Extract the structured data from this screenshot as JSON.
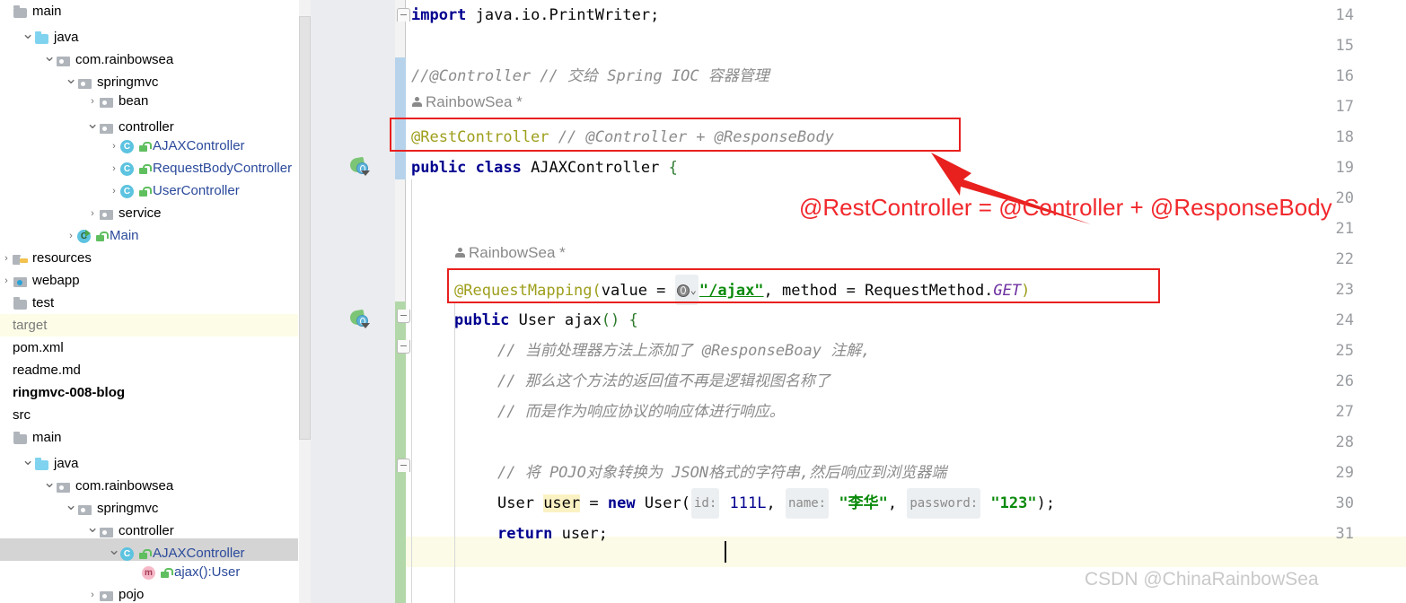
{
  "sidebar": {
    "scrollbar": "vertical-scrollbar",
    "items": [
      {
        "label": "main",
        "indent": 0,
        "arrow": "none",
        "icon": "folder-gray",
        "state": "normal"
      },
      {
        "label": "java",
        "indent": 1,
        "arrow": "down",
        "icon": "folder-blue",
        "state": "normal"
      },
      {
        "label": "com.rainbowsea",
        "indent": 2,
        "arrow": "down",
        "icon": "package",
        "state": "normal"
      },
      {
        "label": "springmvc",
        "indent": 3,
        "arrow": "down",
        "icon": "package",
        "state": "normal"
      },
      {
        "label": "bean",
        "indent": 4,
        "arrow": "right",
        "icon": "package",
        "state": "normal"
      },
      {
        "label": "controller",
        "indent": 4,
        "arrow": "down",
        "icon": "package",
        "state": "normal"
      },
      {
        "label": "AJAXController",
        "indent": 5,
        "arrow": "right",
        "icon": "class",
        "state": "normal"
      },
      {
        "label": "RequestBodyController",
        "indent": 5,
        "arrow": "right",
        "icon": "class",
        "state": "normal"
      },
      {
        "label": "UserController",
        "indent": 5,
        "arrow": "right",
        "icon": "class",
        "state": "normal"
      },
      {
        "label": "service",
        "indent": 4,
        "arrow": "right",
        "icon": "package",
        "state": "normal"
      },
      {
        "label": "Main",
        "indent": 3,
        "arrow": "right",
        "icon": "class-main",
        "state": "normal"
      },
      {
        "label": "resources",
        "indent": 0,
        "arrow": "right",
        "icon": "resources",
        "state": "normal"
      },
      {
        "label": "webapp",
        "indent": 0,
        "arrow": "right",
        "icon": "webapp",
        "state": "normal"
      },
      {
        "label": "test",
        "indent": 0,
        "arrow": "none",
        "icon": "folder-gray",
        "state": "normal"
      },
      {
        "label": "target",
        "indent": 0,
        "arrow": "none",
        "icon": "none",
        "state": "highlight"
      },
      {
        "label": "pom.xml",
        "indent": 0,
        "arrow": "none",
        "icon": "none",
        "state": "normal"
      },
      {
        "label": "readme.md",
        "indent": 0,
        "arrow": "none",
        "icon": "none",
        "state": "normal"
      },
      {
        "label": "ringmvc-008-blog",
        "indent": 0,
        "arrow": "none",
        "icon": "none",
        "state": "bold"
      },
      {
        "label": "src",
        "indent": 0,
        "arrow": "none",
        "icon": "none",
        "state": "normal"
      },
      {
        "label": "main",
        "indent": 0,
        "arrow": "none",
        "icon": "folder-gray",
        "state": "normal"
      },
      {
        "label": "java",
        "indent": 1,
        "arrow": "down",
        "icon": "folder-blue",
        "state": "normal"
      },
      {
        "label": "com.rainbowsea",
        "indent": 2,
        "arrow": "down",
        "icon": "package",
        "state": "normal"
      },
      {
        "label": "springmvc",
        "indent": 3,
        "arrow": "down",
        "icon": "package",
        "state": "normal"
      },
      {
        "label": "controller",
        "indent": 4,
        "arrow": "down",
        "icon": "package",
        "state": "normal"
      },
      {
        "label": "AJAXController",
        "indent": 5,
        "arrow": "down",
        "icon": "class",
        "state": "selected"
      },
      {
        "label": "ajax():User",
        "indent": 6,
        "arrow": "none",
        "icon": "method",
        "state": "normal"
      },
      {
        "label": "pojo",
        "indent": 4,
        "arrow": "right",
        "icon": "package",
        "state": "normal"
      }
    ]
  },
  "editor": {
    "line_numbers": [
      "14",
      "15",
      "16",
      "17",
      "18",
      "19",
      "20",
      "21",
      "22",
      "23",
      "24",
      "25",
      "26",
      "27",
      "28",
      "29",
      "30",
      "31"
    ],
    "caret_line": "30",
    "inlay_hints": [
      {
        "text": "RainbowSea *",
        "icon": "author-icon",
        "line": "16"
      },
      {
        "text": "RainbowSea *",
        "icon": "author-icon",
        "line": "20"
      }
    ],
    "lines": {
      "l14": "import java.io.PrintWriter;",
      "l16": "//@Controller  // 交给 Spring IOC 容器管理",
      "l17_annotation": "@RestController",
      "l17_comment": "// @Controller + @ResponseBody",
      "l18": "public class AJAXController {",
      "l21_annotation": "@RequestMapping(",
      "l21_param1": "value = ",
      "l21_value": "\"/ajax\"",
      "l21_param2": ", method = RequestMethod.",
      "l21_get": "GET",
      "l21_close": ")",
      "l22": "public User ajax() {",
      "l23": "// 当前处理器方法上添加了 @ResponseBoay 注解,",
      "l24": "// 那么这个方法的返回值不再是逻辑视图名称了",
      "l25": "// 而是作为响应协议的响应体进行响应。",
      "l27": "// 将 POJO对象转换为 JSON格式的字符串,然后响应到浏览器端",
      "l28_type": "User ",
      "l28_var": "user",
      "l28_eq": " = ",
      "l28_new": "new",
      "l28_ctor": " User(",
      "l28_hint_id": "id:",
      "l28_id": "111L",
      "l28_sep1": ",",
      "l28_hint_name": "name:",
      "l28_name": "\"李华\"",
      "l28_sep2": ",",
      "l28_hint_pw": "password:",
      "l28_pw": "\"123\"",
      "l28_tail": ");",
      "l29_kw": "return",
      "l29_rest": " user;"
    }
  },
  "annotations": {
    "red_note": "@RestController = @Controller + @ResponseBody",
    "red_color": "#f1282c",
    "box1_target": "line-17-restcontroller",
    "box2_target": "line-21-requestmapping",
    "arrow": "red-arrow"
  },
  "watermark": {
    "text": "CSDN @ChinaRainbowSea"
  }
}
